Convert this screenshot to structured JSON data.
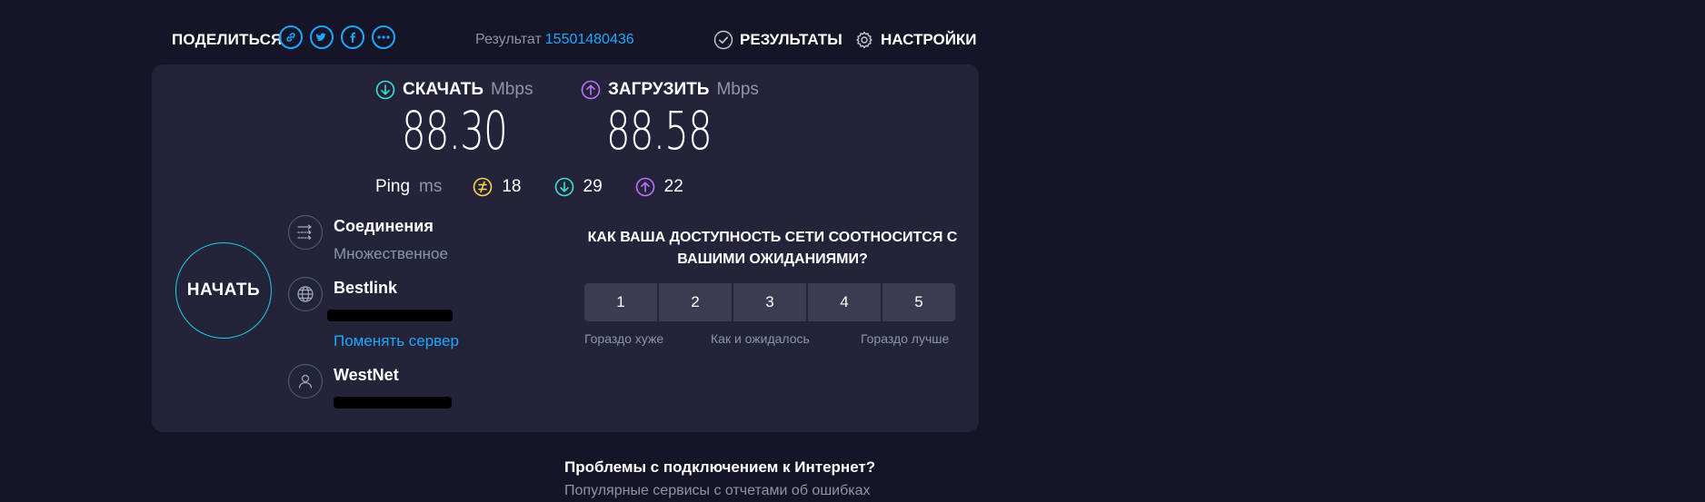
{
  "header": {
    "share_label": "ПОДЕЛИТЬСЯ",
    "share_icons": [
      "link-icon",
      "twitter-icon",
      "facebook-icon",
      "more-icon"
    ],
    "result_label": "Результат",
    "result_id": "15501480436",
    "results_label": "РЕЗУЛЬТАТЫ",
    "settings_label": "НАСТРОЙКИ"
  },
  "speed": {
    "download_label": "СКАЧАТЬ",
    "upload_label": "ЗАГРУЗИТЬ",
    "unit": "Mbps",
    "download_value": "88.30",
    "upload_value": "88.58"
  },
  "ping": {
    "label": "Ping",
    "unit": "ms",
    "idle": "18",
    "download": "29",
    "upload": "22"
  },
  "start_button": "НАЧАТЬ",
  "connection": {
    "connections_title": "Соединения",
    "connections_value": "Множественное",
    "server_title": "Bestlink",
    "change_server": "Поменять сервер",
    "provider_title": "WestNet"
  },
  "survey": {
    "question": "КАК ВАША ДОСТУПНОСТЬ СЕТИ СООТНОСИТСЯ С ВАШИМИ ОЖИДАНИЯМИ?",
    "options": [
      "1",
      "2",
      "3",
      "4",
      "5"
    ],
    "label_low": "Гораздо хуже",
    "label_mid": "Как и ожидалось",
    "label_high": "Гораздо лучше"
  },
  "problems": {
    "title": "Проблемы с подключением к Интернет?",
    "subtitle": "Популярные сервисы с отчетами об ошибках"
  },
  "colors": {
    "background": "#141526",
    "card": "#23243a",
    "accent_blue": "#1ea7ff",
    "download_cyan": "#3ee0d0",
    "upload_purple": "#bf71ff",
    "idle_yellow": "#ffd54a",
    "start_ring": "#1cd0e6"
  }
}
